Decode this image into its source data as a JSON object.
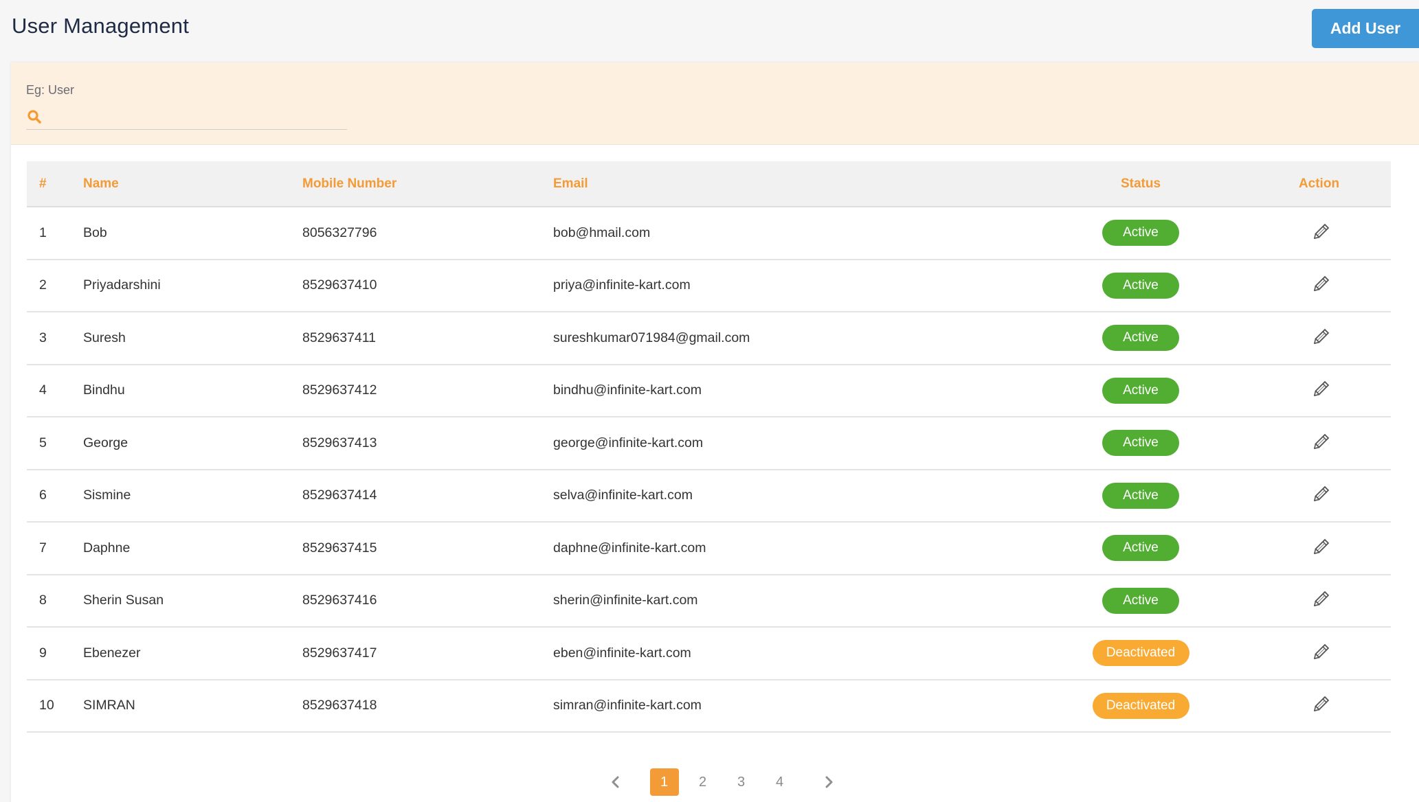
{
  "header": {
    "title": "User Management",
    "add_user_label": "Add User"
  },
  "search": {
    "label": "Eg: User",
    "value": "",
    "placeholder": "",
    "icon": "search-icon"
  },
  "table": {
    "columns": [
      "#",
      "Name",
      "Mobile Number",
      "Email",
      "Status",
      "Action"
    ],
    "rows": [
      {
        "num": "1",
        "name": "Bob",
        "mobile": "8056327796",
        "email": "bob@hmail.com",
        "status": "Active"
      },
      {
        "num": "2",
        "name": "Priyadarshini",
        "mobile": "8529637410",
        "email": "priya@infinite-kart.com",
        "status": "Active"
      },
      {
        "num": "3",
        "name": "Suresh",
        "mobile": "8529637411",
        "email": "sureshkumar071984@gmail.com",
        "status": "Active"
      },
      {
        "num": "4",
        "name": "Bindhu",
        "mobile": "8529637412",
        "email": "bindhu@infinite-kart.com",
        "status": "Active"
      },
      {
        "num": "5",
        "name": "George",
        "mobile": "8529637413",
        "email": "george@infinite-kart.com",
        "status": "Active"
      },
      {
        "num": "6",
        "name": "Sismine",
        "mobile": "8529637414",
        "email": "selva@infinite-kart.com",
        "status": "Active"
      },
      {
        "num": "7",
        "name": "Daphne",
        "mobile": "8529637415",
        "email": "daphne@infinite-kart.com",
        "status": "Active"
      },
      {
        "num": "8",
        "name": "Sherin Susan",
        "mobile": "8529637416",
        "email": "sherin@infinite-kart.com",
        "status": "Active"
      },
      {
        "num": "9",
        "name": "Ebenezer",
        "mobile": "8529637417",
        "email": "eben@infinite-kart.com",
        "status": "Deactivated"
      },
      {
        "num": "10",
        "name": "SIMRAN",
        "mobile": "8529637418",
        "email": "simran@infinite-kart.com",
        "status": "Deactivated"
      }
    ],
    "action_icon": "pencil-icon"
  },
  "pagination": {
    "pages": [
      "1",
      "2",
      "3",
      "4"
    ],
    "current": "1",
    "prev_icon": "chevron-left-icon",
    "next_icon": "chevron-right-icon"
  },
  "colors": {
    "accent": "#f39b37",
    "primary_button": "#3f97d7",
    "active": "#52ae33",
    "deactivated": "#f9aa32",
    "search_bg": "#fdf0e1",
    "title": "#1f2a44"
  }
}
